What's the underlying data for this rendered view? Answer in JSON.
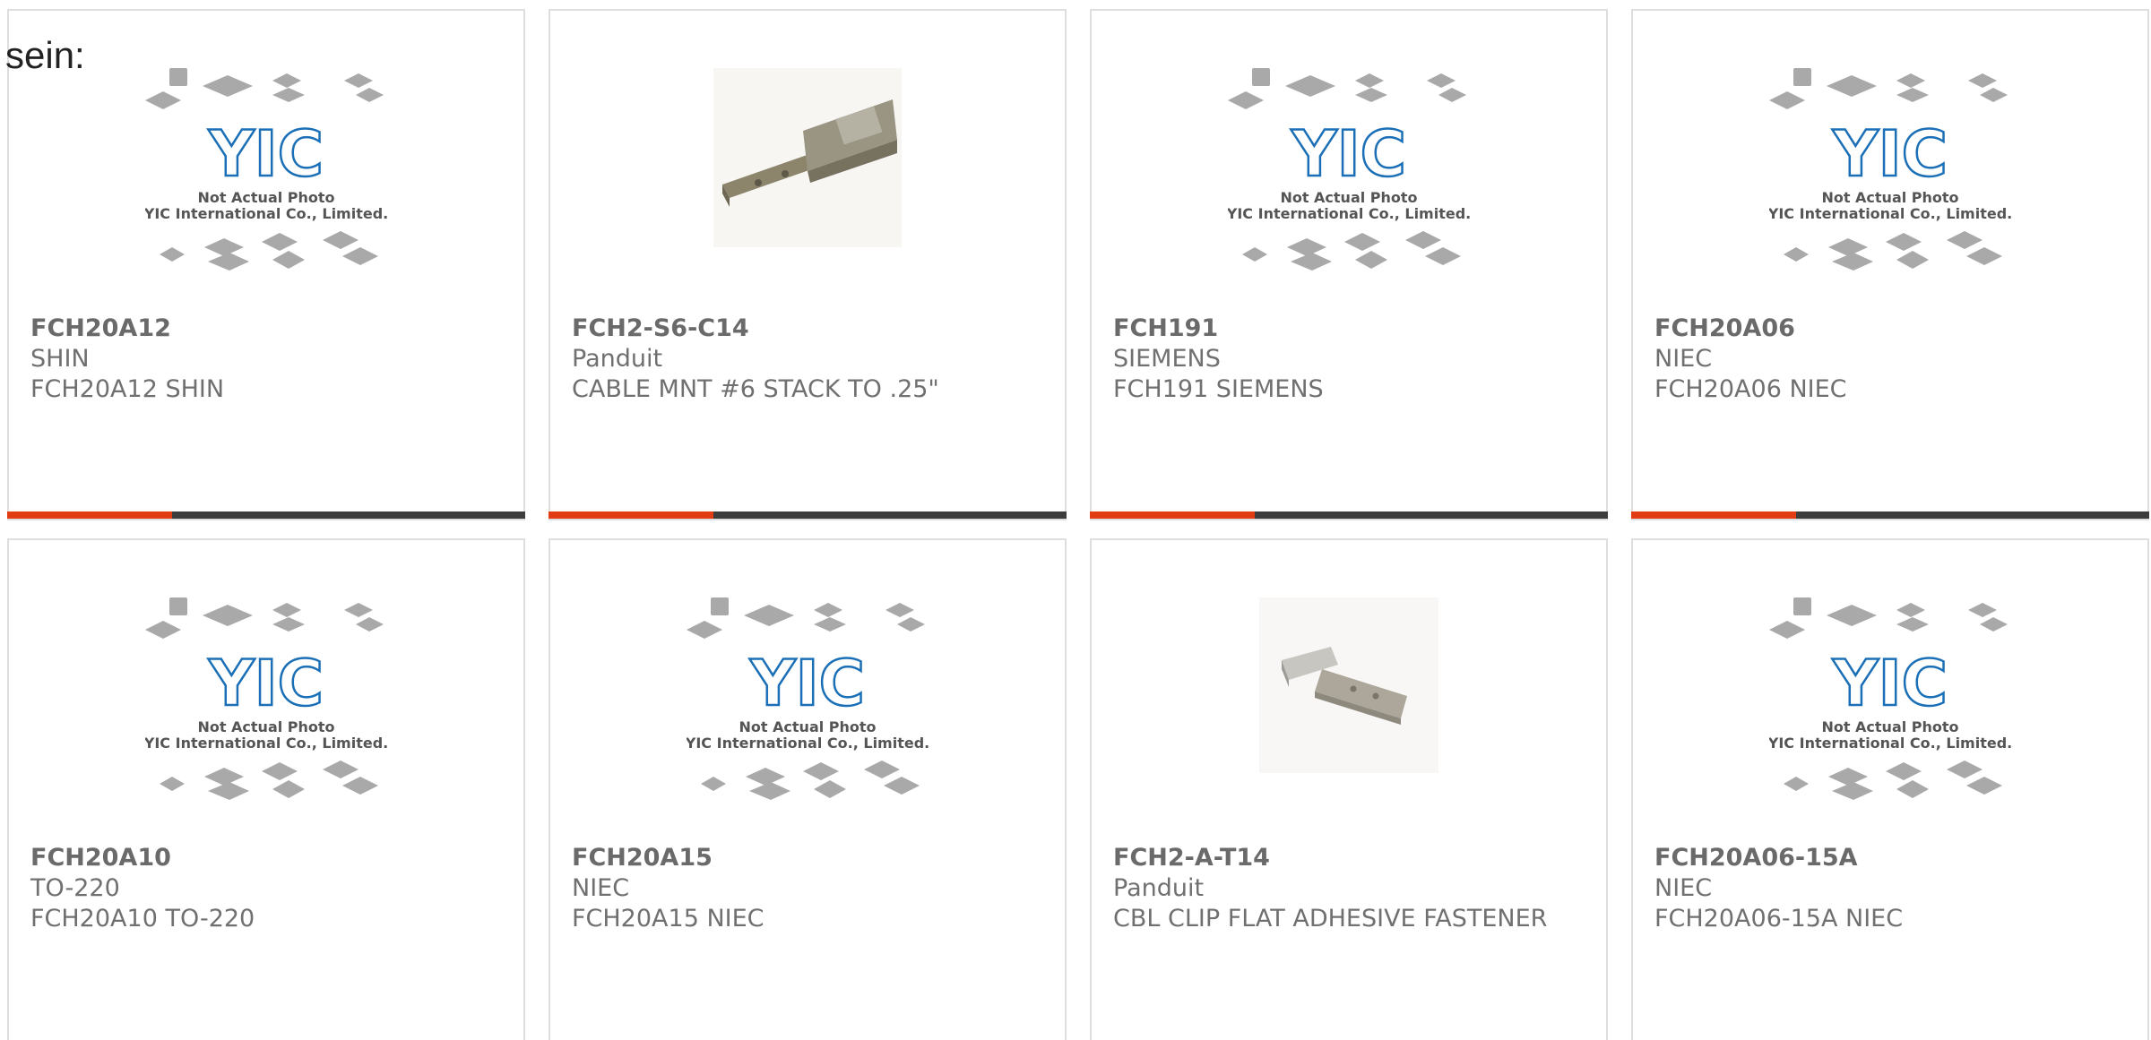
{
  "page": {
    "prefix_text": "sein:"
  },
  "placeholder": {
    "line1": "Not Actual Photo",
    "line2": "YIC International Co., Limited.",
    "logo": "YIC"
  },
  "products": [
    {
      "part": "FCH20A12",
      "brand": "SHIN",
      "desc": "FCH20A12 SHIN",
      "image": "yic-placeholder"
    },
    {
      "part": "FCH2-S6-C14",
      "brand": "Panduit",
      "desc": "CABLE MNT #6 STACK TO .25\"",
      "image": "cable-mount-photo"
    },
    {
      "part": "FCH191",
      "brand": "SIEMENS",
      "desc": "FCH191 SIEMENS",
      "image": "yic-placeholder"
    },
    {
      "part": "FCH20A06",
      "brand": "NIEC",
      "desc": "FCH20A06 NIEC",
      "image": "yic-placeholder"
    },
    {
      "part": "FCH20A10",
      "brand": "TO-220",
      "desc": "FCH20A10 TO-220",
      "image": "yic-placeholder"
    },
    {
      "part": "FCH20A15",
      "brand": "NIEC",
      "desc": "FCH20A15 NIEC",
      "image": "yic-placeholder"
    },
    {
      "part": "FCH2-A-T14",
      "brand": "Panduit",
      "desc": "CBL CLIP FLAT ADHESIVE FASTENER",
      "image": "cable-clip-photo"
    },
    {
      "part": "FCH20A06-15A",
      "brand": "NIEC",
      "desc": "FCH20A06-15A NIEC",
      "image": "yic-placeholder"
    }
  ],
  "colors": {
    "accent": "#e23c13",
    "bar": "#3d3d3d",
    "logo_blue": "#1a6fb6",
    "text_gray": "#707070"
  }
}
